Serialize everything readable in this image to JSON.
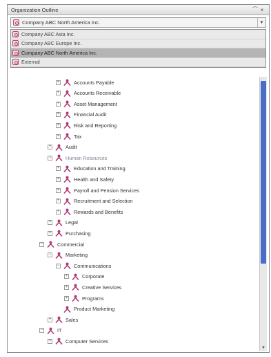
{
  "window": {
    "title": "Organization Outline",
    "pin_glyph": "⁀",
    "close_glyph": "×"
  },
  "company_selector": {
    "value": "Company ABC North America Inc.",
    "arrow_glyph": "▼"
  },
  "company_options": [
    {
      "label": "Company ABC Asia Inc.",
      "selected": false
    },
    {
      "label": "Company ABC Europe Inc.",
      "selected": false
    },
    {
      "label": "Company ABC North America Inc.",
      "selected": true
    },
    {
      "label": "External",
      "selected": false
    }
  ],
  "tree": [
    {
      "label": "Accounts Payable",
      "level": 3,
      "toggle": "+"
    },
    {
      "label": "Accounts Receivable",
      "level": 3,
      "toggle": "+"
    },
    {
      "label": "Asset Management",
      "level": 3,
      "toggle": "+"
    },
    {
      "label": "Financial Audit",
      "level": 3,
      "toggle": "+"
    },
    {
      "label": "Risk and Reporting",
      "level": 3,
      "toggle": "+"
    },
    {
      "label": "Tax",
      "level": 3,
      "toggle": "+"
    },
    {
      "label": "Audit",
      "level": 2,
      "toggle": "+"
    },
    {
      "label": "Human Resources",
      "level": 2,
      "toggle": "−",
      "dim": true
    },
    {
      "label": "Education and Training",
      "level": 3,
      "toggle": "+"
    },
    {
      "label": "Health and Safety",
      "level": 3,
      "toggle": "+"
    },
    {
      "label": "Payroll and Pension Services",
      "level": 3,
      "toggle": "+"
    },
    {
      "label": "Recruitment and Selection",
      "level": 3,
      "toggle": "+"
    },
    {
      "label": "Rewards and Benefits",
      "level": 3,
      "toggle": "+"
    },
    {
      "label": "Legal",
      "level": 2,
      "toggle": "+"
    },
    {
      "label": "Purchasing",
      "level": 2,
      "toggle": "+"
    },
    {
      "label": "Commercial",
      "level": 1,
      "toggle": "−"
    },
    {
      "label": "Marketing",
      "level": 2,
      "toggle": "−"
    },
    {
      "label": "Communications",
      "level": 3,
      "toggle": "−"
    },
    {
      "label": "Corporate",
      "level": 4,
      "toggle": "+"
    },
    {
      "label": "Creative Services",
      "level": 4,
      "toggle": "+"
    },
    {
      "label": "Programs",
      "level": 4,
      "toggle": "+"
    },
    {
      "label": "Product Marketing",
      "level": 3,
      "toggle": ""
    },
    {
      "label": "Sales",
      "level": 2,
      "toggle": "+"
    },
    {
      "label": "IT",
      "level": 1,
      "toggle": "−"
    },
    {
      "label": "Computer Services",
      "level": 2,
      "toggle": "+"
    }
  ],
  "scrollbar": {
    "up_glyph": "▲",
    "down_glyph": "▼"
  },
  "colors": {
    "org_icon": "#b03a78",
    "scroll_thumb": "#4a6dc6",
    "selected_row": "#b4b4b4"
  }
}
